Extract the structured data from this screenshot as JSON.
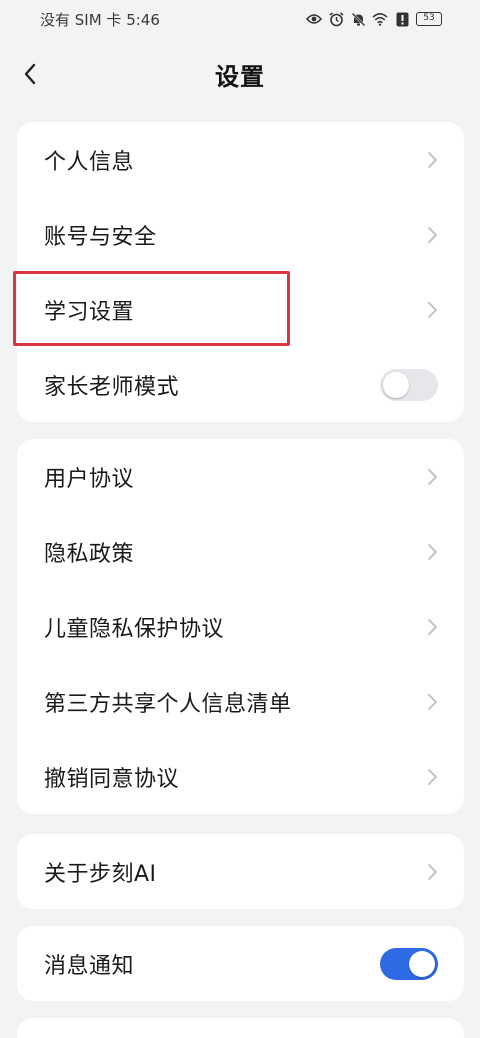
{
  "status_bar": {
    "carrier_time": "没有 SIM 卡 5:46",
    "battery": "53"
  },
  "header": {
    "title": "设置"
  },
  "sections": [
    {
      "items": [
        {
          "label": "个人信息",
          "control": "chevron"
        },
        {
          "label": "账号与安全",
          "control": "chevron"
        },
        {
          "label": "学习设置",
          "control": "chevron",
          "highlighted": true
        },
        {
          "label": "家长老师模式",
          "control": "toggle",
          "toggle_on": false
        }
      ]
    },
    {
      "items": [
        {
          "label": "用户协议",
          "control": "chevron"
        },
        {
          "label": "隐私政策",
          "control": "chevron"
        },
        {
          "label": "儿童隐私保护协议",
          "control": "chevron"
        },
        {
          "label": "第三方共享个人信息清单",
          "control": "chevron"
        },
        {
          "label": "撤销同意协议",
          "control": "chevron"
        }
      ]
    },
    {
      "items": [
        {
          "label": "关于步刻AI",
          "control": "chevron"
        }
      ]
    },
    {
      "items": [
        {
          "label": "消息通知",
          "control": "toggle",
          "toggle_on": true
        }
      ]
    }
  ],
  "colors": {
    "background": "#f2f3f5",
    "card": "#ffffff",
    "toggle_on": "#2f6ae5",
    "toggle_off": "#e6e7ea",
    "highlight": "#d9363e",
    "chevron": "#c4c4c6"
  }
}
